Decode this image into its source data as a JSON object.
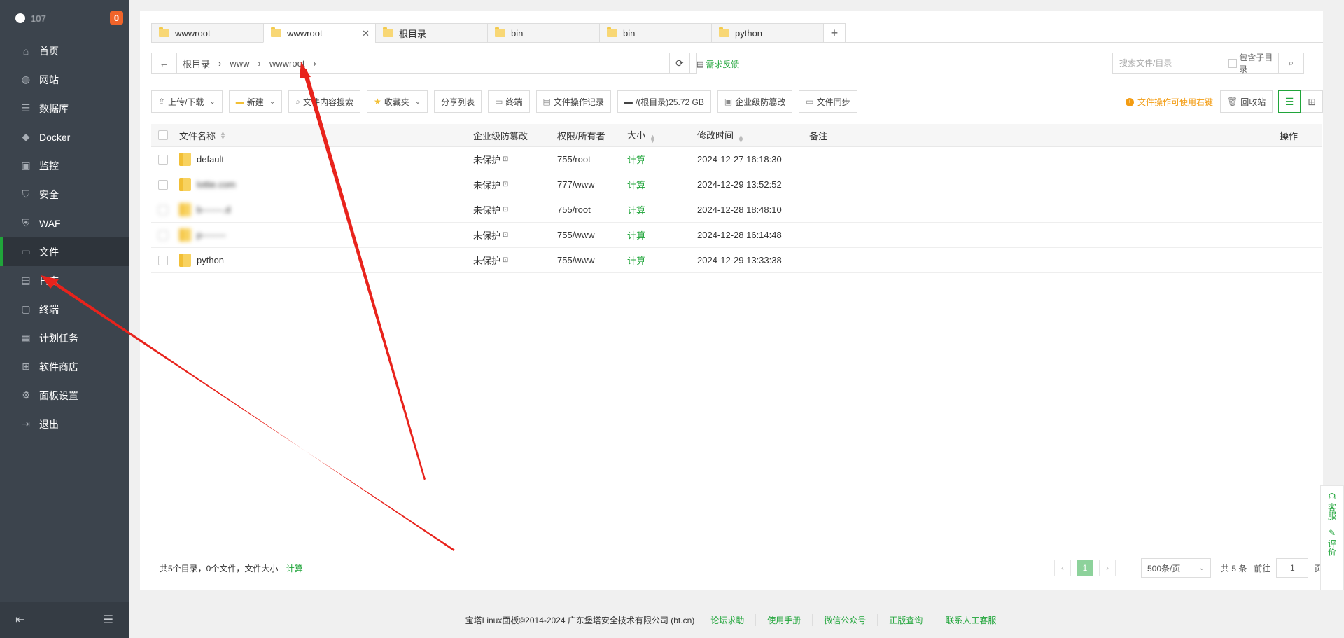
{
  "sidebar": {
    "ip_text": "107",
    "badge": "0",
    "items": [
      {
        "label": "首页",
        "icon": "home-icon"
      },
      {
        "label": "网站",
        "icon": "globe-icon"
      },
      {
        "label": "数据库",
        "icon": "database-icon"
      },
      {
        "label": "Docker",
        "icon": "docker-icon"
      },
      {
        "label": "监控",
        "icon": "monitor-icon"
      },
      {
        "label": "安全",
        "icon": "shield-icon"
      },
      {
        "label": "WAF",
        "icon": "waf-icon"
      },
      {
        "label": "文件",
        "icon": "folder-icon"
      },
      {
        "label": "日志",
        "icon": "log-icon"
      },
      {
        "label": "终端",
        "icon": "terminal-icon"
      },
      {
        "label": "计划任务",
        "icon": "calendar-icon"
      },
      {
        "label": "软件商店",
        "icon": "apps-icon"
      },
      {
        "label": "面板设置",
        "icon": "settings-icon"
      },
      {
        "label": "退出",
        "icon": "logout-icon"
      }
    ],
    "active_index": 7
  },
  "tabs": [
    {
      "label": "wwwroot"
    },
    {
      "label": "wwwroot"
    },
    {
      "label": "根目录"
    },
    {
      "label": "bin"
    },
    {
      "label": "bin"
    },
    {
      "label": "python"
    }
  ],
  "tab_add": "+",
  "path": {
    "crumbs": [
      "根目录",
      "www",
      "wwwroot"
    ],
    "feedback": "需求反馈"
  },
  "search": {
    "placeholder": "搜索文件/目录",
    "include_subdir": "包含子目录"
  },
  "toolbar": {
    "upload": "上传/下载",
    "new": "新建",
    "content_search": "文件内容搜索",
    "favorites": "收藏夹",
    "share_list": "分享列表",
    "terminal": "终端",
    "op_log": "文件操作记录",
    "disk": "/(根目录)25.72 GB",
    "tamper": "企业级防篡改",
    "sync": "文件同步",
    "tip": "文件操作可使用右键",
    "recycle": "回收站"
  },
  "table": {
    "headers": {
      "name": "文件名称",
      "protect": "企业级防篡改",
      "perm": "权限/所有者",
      "size": "大小",
      "mtime": "修改时间",
      "note": "备注",
      "op": "操作"
    },
    "rows": [
      {
        "name": "default",
        "protect": "未保护",
        "perm": "755/root",
        "size": "计算",
        "mtime": "2024-12-27 16:18:30"
      },
      {
        "name": "lottie.com",
        "protect": "未保护",
        "perm": "777/www",
        "size": "计算",
        "mtime": "2024-12-29 13:52:52"
      },
      {
        "name": "b-------.d",
        "protect": "未保护",
        "perm": "755/root",
        "size": "计算",
        "mtime": "2024-12-28 18:48:10"
      },
      {
        "name": "p--------",
        "protect": "未保护",
        "perm": "755/www",
        "size": "计算",
        "mtime": "2024-12-28 16:14:48"
      },
      {
        "name": "python",
        "protect": "未保护",
        "perm": "755/www",
        "size": "计算",
        "mtime": "2024-12-29 13:33:38"
      }
    ]
  },
  "summary": {
    "text": "共5个目录，0个文件，文件大小",
    "calc": "计算"
  },
  "pager": {
    "current": "1",
    "page_size": "500条/页",
    "total": "共 5 条",
    "goto": "前往",
    "page_input": "1",
    "page_unit": "页"
  },
  "float": {
    "service": "客服",
    "review": "评价"
  },
  "footer": {
    "copyright": "宝塔Linux面板©2014-2024 广东堡塔安全技术有限公司 (bt.cn)",
    "links": [
      "论坛求助",
      "使用手册",
      "微信公众号",
      "正版查询",
      "联系人工客服"
    ]
  },
  "colors": {
    "accent": "#20a53a",
    "sidebar_bg": "#3c444d",
    "badge": "#f0642a",
    "warning": "#f39c12",
    "annotation": "#e8231c"
  }
}
